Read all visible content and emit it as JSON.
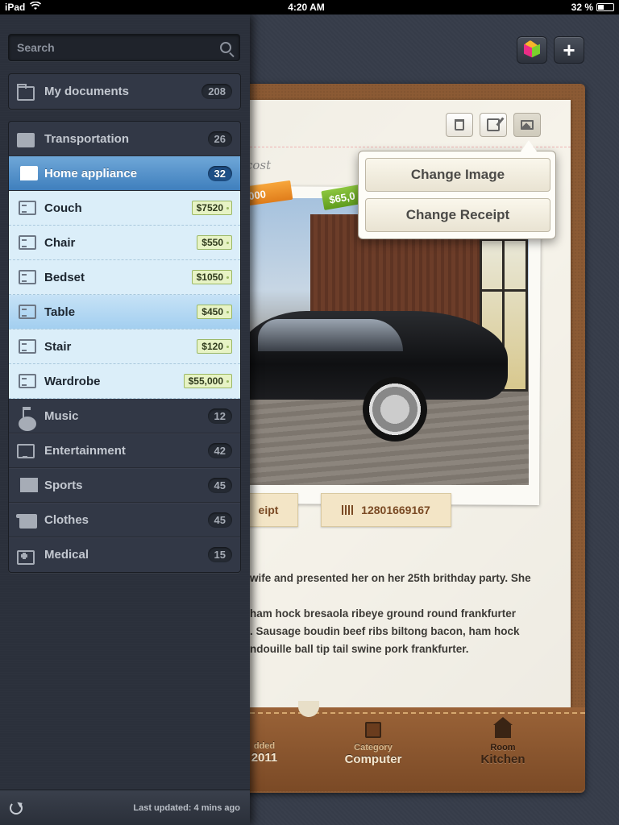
{
  "status": {
    "device": "iPad",
    "time": "4:20 AM",
    "battery": "32 %",
    "battery_level": 0.32
  },
  "search": {
    "placeholder": "Search"
  },
  "documents": {
    "label": "My documents",
    "count": "208"
  },
  "categories": [
    {
      "label": "Transportation",
      "count": "26",
      "icon": "truck-icon"
    },
    {
      "label": "Home appliance",
      "count": "32",
      "icon": "lamp-icon",
      "selected": true
    }
  ],
  "items": [
    {
      "label": "Couch",
      "price": "$7520"
    },
    {
      "label": "Chair",
      "price": "$550"
    },
    {
      "label": "Bedset",
      "price": "$1050"
    },
    {
      "label": "Table",
      "price": "$450",
      "highlight": true
    },
    {
      "label": "Stair",
      "price": "$120"
    },
    {
      "label": "Wardrobe",
      "price": "$55,000"
    }
  ],
  "more_categories": [
    {
      "label": "Music",
      "count": "12",
      "icon": "music-note-icon"
    },
    {
      "label": "Entertainment",
      "count": "42",
      "icon": "tv-icon"
    },
    {
      "label": "Sports",
      "count": "45",
      "icon": "flag-icon"
    },
    {
      "label": "Clothes",
      "count": "45",
      "icon": "shirt-icon"
    },
    {
      "label": "Medical",
      "count": "15",
      "icon": "medical-kit-icon"
    }
  ],
  "footer": {
    "last_updated": "Last updated: 4 mins ago"
  },
  "toolbar": {
    "plus": "+"
  },
  "card": {
    "cost_label": "cost",
    "tag_orange": "000",
    "tag_green": "$65,0",
    "receipt_left": "eipt",
    "receipt_number": "12801669167",
    "description": [
      "wife and presented her on her 25th brithday party. She",
      "",
      "ham hock bresaola ribeye ground round frankfurter",
      ". Sausage boudin beef ribs biltong bacon, ham hock",
      "ndouille ball tip tail swine pork frankfurter."
    ],
    "bottom": {
      "added_label": "dded",
      "added_value": "2011",
      "category_label": "Category",
      "category_value": "Computer",
      "room_label": "Room",
      "room_value": "Kitchen"
    }
  },
  "popover": {
    "change_image": "Change Image",
    "change_receipt": "Change Receipt"
  }
}
